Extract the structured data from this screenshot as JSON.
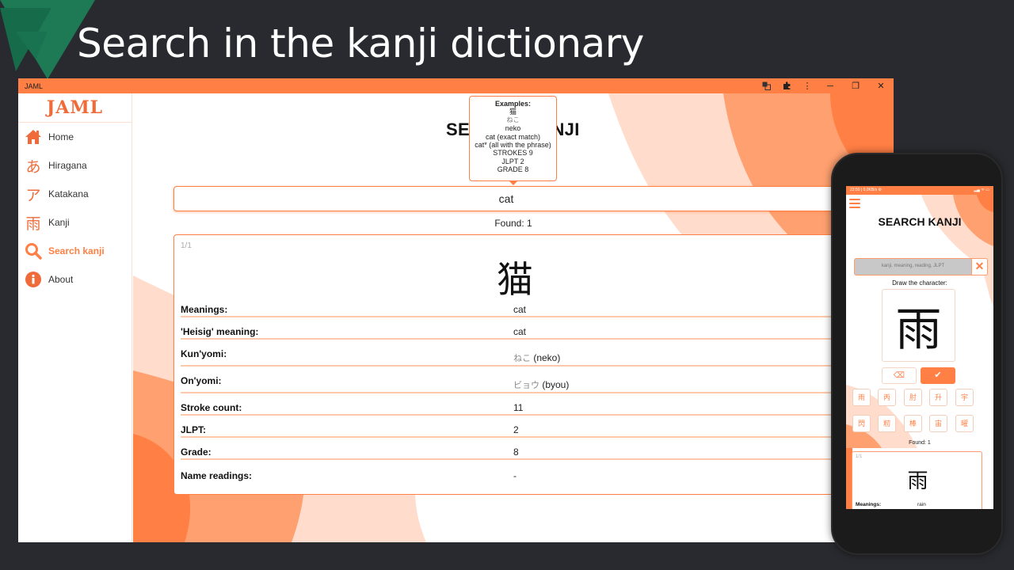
{
  "slide": {
    "title": "Search in the kanji dictionary"
  },
  "window": {
    "app_name": "JAML",
    "controls": {
      "translate_icon": "translate-icon",
      "extensions_icon": "puzzle-icon",
      "menu_icon": "⋮",
      "minimize": "─",
      "maximize": "❐",
      "close": "✕"
    }
  },
  "sidebar": {
    "logo": "JAML",
    "items": [
      {
        "label": "Home",
        "icon": "home-icon",
        "glyph": "",
        "active": false
      },
      {
        "label": "Hiragana",
        "icon": "hiragana-icon",
        "glyph": "あ",
        "active": false
      },
      {
        "label": "Katakana",
        "icon": "katakana-icon",
        "glyph": "ア",
        "active": false
      },
      {
        "label": "Kanji",
        "icon": "kanji-icon",
        "glyph": "雨",
        "active": false
      },
      {
        "label": "Search kanji",
        "icon": "search-icon",
        "glyph": "",
        "active": true
      },
      {
        "label": "About",
        "icon": "info-icon",
        "glyph": "i",
        "active": false
      }
    ]
  },
  "main": {
    "title": "SEARCH KANJI",
    "tooltip": {
      "heading": "Examples:",
      "lines": [
        "猫",
        "ねこ",
        "neko",
        "cat (exact match)",
        "cat* (all with the phrase)",
        "STROKES 9",
        "JLPT 2",
        "GRADE 8"
      ]
    },
    "search": {
      "value": "cat"
    },
    "found": "Found: 1",
    "result": {
      "counter": "1/1",
      "kanji": "猫",
      "rows": [
        {
          "label": "Meanings:",
          "value": "cat",
          "jp": ""
        },
        {
          "label": "'Heisig' meaning:",
          "value": "cat",
          "jp": ""
        },
        {
          "label": "Kun'yomi:",
          "value": " (neko)",
          "jp": "ねこ"
        },
        {
          "label": "On'yomi:",
          "value": " (byou)",
          "jp": "ビョウ"
        },
        {
          "label": "Stroke count:",
          "value": "11",
          "jp": ""
        },
        {
          "label": "JLPT:",
          "value": "2",
          "jp": ""
        },
        {
          "label": "Grade:",
          "value": "8",
          "jp": ""
        },
        {
          "label": "Name readings:",
          "value": "-",
          "jp": ""
        }
      ]
    }
  },
  "phone": {
    "status_left": "22:50 | 0,0KB/s ⚙",
    "status_right": "▂▄ ᯤ ▭",
    "title": "SEARCH KANJI",
    "search_placeholder": "kanji, meaning, reading, JLPT",
    "clear_label": "✕",
    "draw_label": "Draw the character:",
    "drawn_character": "雨",
    "erase_label": "⌫",
    "confirm_label": "✔",
    "candidates": [
      "雨",
      "丙",
      "肘",
      "升",
      "宇",
      "閃",
      "籾",
      "棒",
      "宙",
      "曜"
    ],
    "found": "Found: 1",
    "result": {
      "counter": "1/1",
      "kanji": "雨",
      "meanings_label": "Meanings:",
      "meanings_value": "rain"
    }
  },
  "colors": {
    "accent": "#ff7f44",
    "accent_light": "#ffa070",
    "accent_pale": "#ffdccb",
    "slide_bg": "#292a2f",
    "slide_deco": "#1e7a57"
  }
}
